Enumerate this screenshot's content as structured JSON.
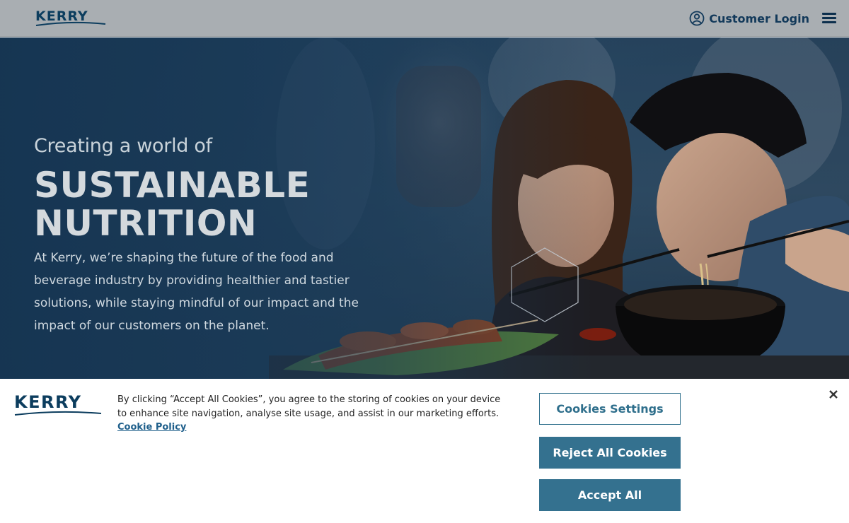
{
  "header": {
    "logo_text": "KERRY",
    "login_label": "Customer Login"
  },
  "hero": {
    "pretitle": "Creating a world of",
    "title_line1": "SUSTAINABLE",
    "title_line2": "NUTRITION",
    "body": "At Kerry, we’re shaping the future of the food and beverage industry by providing healthier and tastier solutions, while staying mindful of our impact and the impact of our customers on the planet."
  },
  "cookie_banner": {
    "logo_text": "KERRY",
    "message": "By clicking “Accept All Cookies”, you agree to the storing of cookies on your device to enhance site navigation, analyse site usage, and assist in our marketing efforts.",
    "policy_link": "Cookie Policy",
    "settings_label": "Cookies Settings",
    "reject_label": "Reject All Cookies",
    "accept_label": "Accept All"
  },
  "colors": {
    "brand_navy": "#0c3d5e",
    "button_teal": "#34718f",
    "header_bg": "#a9aeb2"
  }
}
